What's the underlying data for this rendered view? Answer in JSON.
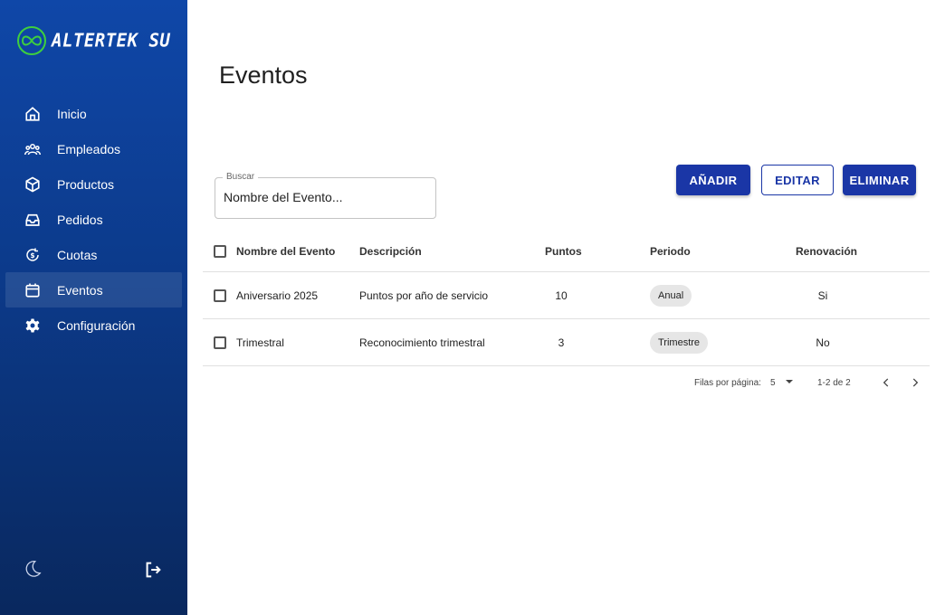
{
  "brand": {
    "name": "ALTERTEK SU",
    "logo_icon": "infinity-icon"
  },
  "sidebar": {
    "items": [
      {
        "label": "Inicio",
        "icon": "home-icon"
      },
      {
        "label": "Empleados",
        "icon": "users-icon"
      },
      {
        "label": "Productos",
        "icon": "box-icon"
      },
      {
        "label": "Pedidos",
        "icon": "inbox-icon"
      },
      {
        "label": "Cuotas",
        "icon": "dollar-refresh-icon"
      },
      {
        "label": "Eventos",
        "icon": "calendar-icon",
        "active": true
      },
      {
        "label": "Configuración",
        "icon": "gear-icon"
      }
    ],
    "bottom": {
      "theme_icon": "moon-icon",
      "logout_icon": "logout-icon"
    }
  },
  "page": {
    "title": "Eventos"
  },
  "search": {
    "label": "Buscar",
    "placeholder": "Nombre del Evento..."
  },
  "toolbar": {
    "add_label": "AÑADIR",
    "edit_label": "EDITAR",
    "delete_label": "ELIMINAR"
  },
  "table": {
    "headers": [
      "Nombre del Evento",
      "Descripción",
      "Puntos",
      "Periodo",
      "Renovación"
    ],
    "rows": [
      [
        "Aniversario 2025",
        "Puntos por año de servicio",
        "10",
        "Anual",
        "Si"
      ],
      [
        "Trimestral",
        "Reconocimiento trimestral",
        "3",
        "Trimestre",
        "No"
      ]
    ]
  },
  "pagination": {
    "rows_per_page_label": "Filas por página:",
    "rows_per_page": "5",
    "range": "1-2 de 2"
  },
  "colors": {
    "sidebar_top": "#0f47a8",
    "sidebar_bottom": "#09285e",
    "primary": "#1a36a6",
    "logo_green": "#3ecf3e"
  }
}
